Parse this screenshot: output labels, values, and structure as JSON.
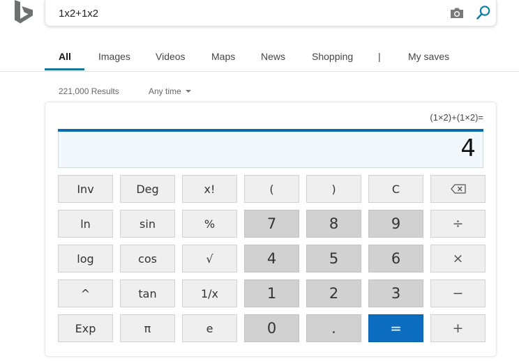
{
  "header": {
    "logo_icon": "bing-logo-icon",
    "search": {
      "value": "1x2+1x2",
      "placeholder": ""
    },
    "camera_icon": "camera-icon",
    "search_icon": "magnifier-icon"
  },
  "nav": {
    "tabs": [
      {
        "label": "All",
        "active": true
      },
      {
        "label": "Images"
      },
      {
        "label": "Videos"
      },
      {
        "label": "Maps"
      },
      {
        "label": "News"
      },
      {
        "label": "Shopping"
      },
      {
        "label": "My saves"
      }
    ],
    "separator": "|"
  },
  "results": {
    "count": "221,000 Results",
    "time_filter": "Any time"
  },
  "calculator": {
    "expression": "(1×2)+(1×2)=",
    "result": "4",
    "keys": [
      [
        "Inv",
        "Deg",
        "x!",
        "(",
        ")",
        "C",
        "⌫"
      ],
      [
        "ln",
        "sin",
        "%",
        "7",
        "8",
        "9",
        "÷"
      ],
      [
        "log",
        "cos",
        "√",
        "4",
        "5",
        "6",
        "×"
      ],
      [
        "^",
        "tan",
        "1/x",
        "1",
        "2",
        "3",
        "−"
      ],
      [
        "Exp",
        "π",
        "e",
        "0",
        ".",
        "=",
        "+"
      ]
    ]
  },
  "colors": {
    "accent": "#17779c",
    "display_bar": "#0c6cb0",
    "equals_button": "#0c6cc0",
    "number_key": "#d1d1d1",
    "function_key": "#efefef"
  }
}
